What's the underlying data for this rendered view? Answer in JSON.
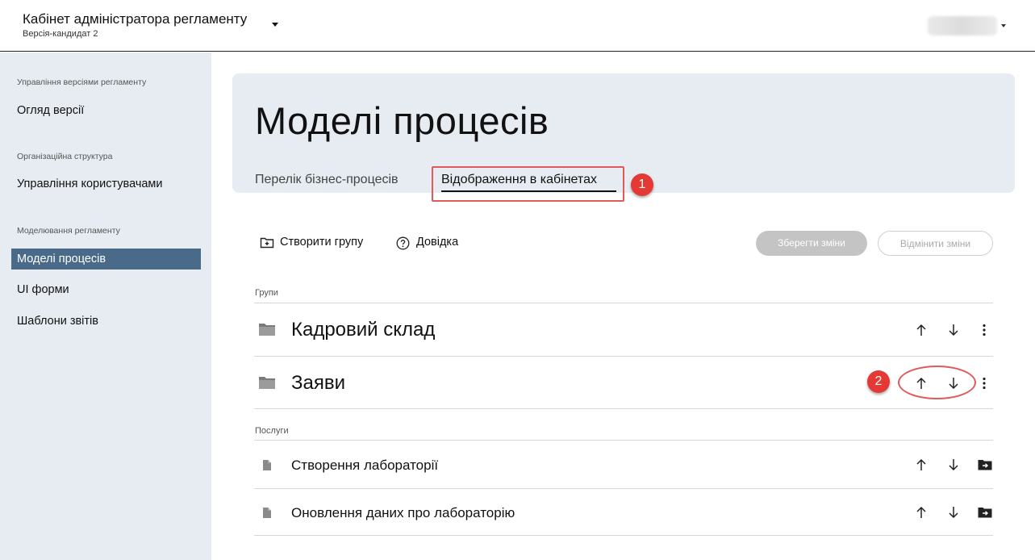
{
  "header": {
    "app_title": "Кабінет адміністратора регламенту",
    "app_subtitle": "Версія-кандидат 2"
  },
  "sidebar": {
    "sections": [
      {
        "label": "Управління версіями регламенту"
      },
      {
        "label": "Організаційна структура"
      },
      {
        "label": "Моделювання регламенту"
      }
    ],
    "items": [
      {
        "label": "Огляд версії"
      },
      {
        "label": "Управління користувачами"
      },
      {
        "label": "Моделі процесів",
        "active": true
      },
      {
        "label": "UI форми"
      },
      {
        "label": "Шаблони звітів"
      }
    ]
  },
  "main": {
    "title": "Моделі процесів",
    "tabs": [
      {
        "label": "Перелік бізнес-процесів"
      },
      {
        "label": "Відображення в кабінетах",
        "active": true
      }
    ],
    "toolbar": {
      "create_group_label": "Створити групу",
      "help_label": "Довідка",
      "save_label": "Зберегти зміни",
      "cancel_label": "Відмінити зміни"
    },
    "groups_label": "Групи",
    "groups": [
      {
        "title": "Кадровий склад"
      },
      {
        "title": "Заяви"
      }
    ],
    "services_label": "Послуги",
    "services": [
      {
        "title": "Створення лабораторії"
      },
      {
        "title": "Оновлення даних про лабораторію"
      }
    ]
  },
  "annotations": {
    "badge_1": "1",
    "badge_2": "2"
  },
  "icons": {
    "folder": "folder-icon",
    "file": "file-icon",
    "up": "arrow-up-icon",
    "down": "arrow-down-icon",
    "more": "more-vertical-icon",
    "move_to_folder": "move-to-folder-icon",
    "create_folder": "create-folder-icon",
    "help": "help-circle-icon"
  },
  "colors": {
    "sidebar_bg": "#e6ecf2",
    "active_item": "#4a6a8a",
    "annotation": "#e53935",
    "disabled_button": "#c4c4c4"
  }
}
